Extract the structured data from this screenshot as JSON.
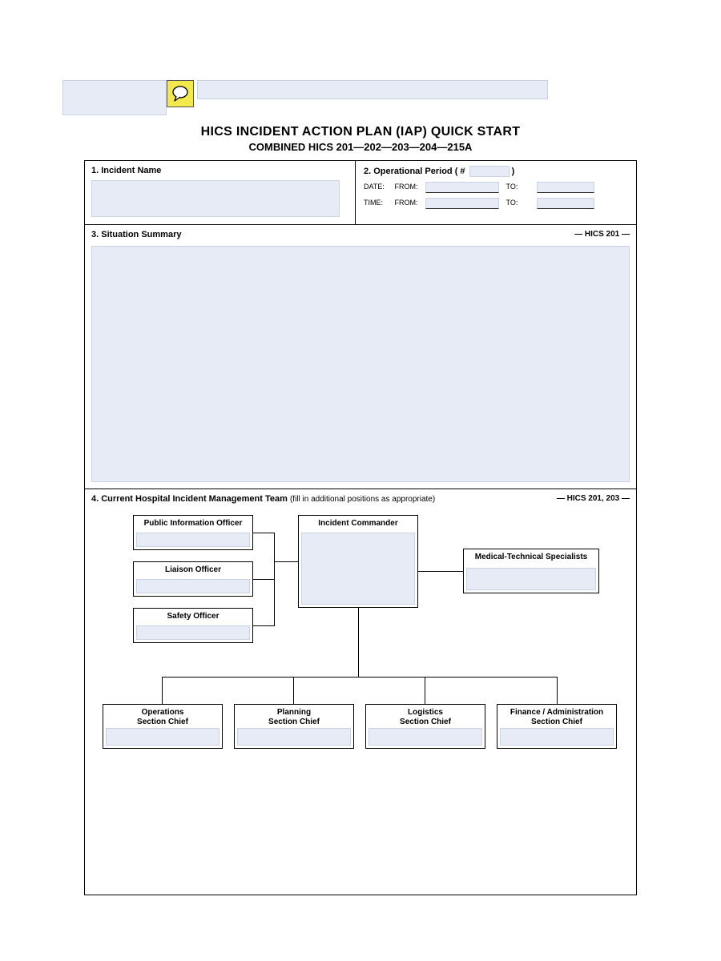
{
  "header": {
    "title": "HICS INCIDENT ACTION PLAN (IAP) QUICK START",
    "subtitle": "COMBINED HICS 201—202—203—204—215A"
  },
  "section1": {
    "label": "1.  Incident Name"
  },
  "section2": {
    "label": "2. Operational Period   ( #",
    "label_close": ")",
    "date_label": "DATE:",
    "time_label": "TIME:",
    "from_label": "FROM:",
    "to_label": "TO:"
  },
  "section3": {
    "label": "3.  Situation Summary",
    "ref": "— HICS 201 —"
  },
  "section4": {
    "label": "4.  Current Hospital Incident Management Team",
    "hint": "(fill in additional positions as appropriate)",
    "ref": "— HICS 201, 203 —",
    "nodes": {
      "pio": "Public Information Officer",
      "liaison": "Liaison Officer",
      "safety": "Safety Officer",
      "commander": "Incident Commander",
      "medtech": "Medical-Technical Specialists",
      "ops": "Operations",
      "plan": "Planning",
      "log": "Logistics",
      "fin": "Finance / Administration",
      "sec_suffix": "Section Chief"
    }
  }
}
